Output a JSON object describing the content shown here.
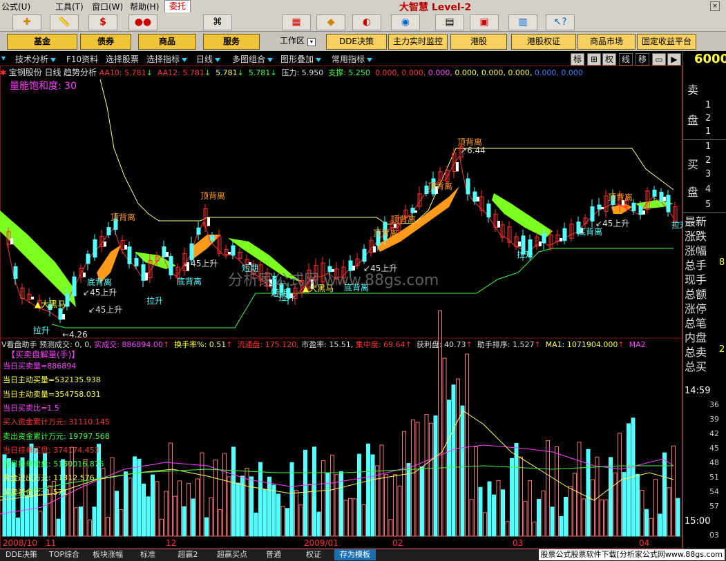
{
  "menu": {
    "items": [
      "公式(U)",
      "工具(T)",
      "窗口(W)",
      "帮助(H)"
    ],
    "entrust": "委托",
    "brand": "大智慧",
    "brand_level": "Level-2"
  },
  "toolbar_icons": [
    "add-icon",
    "ruler-icon",
    "dollar-icon",
    "traffic-light-icon",
    "binoculars-icon",
    "news-icon",
    "diamond-icon",
    "speed-icon",
    "disc-icon",
    "calendar-icon",
    "phone-icon",
    "board-icon",
    "books-icon",
    "help-cursor-icon"
  ],
  "nav_buttons": {
    "fund": "基金",
    "bond": "债券",
    "goods": "商品",
    "service": "服务",
    "workarea": "工作区",
    "dde": "DDE决策",
    "monitor": "主力实时监控",
    "hk": "港股",
    "hk_warrant": "港股权证",
    "goods_market": "商品市场",
    "fixed_income": "固定收益平台"
  },
  "tabs": {
    "tech": "技术分析",
    "f10": "F10资料",
    "pick_stock": "选择股票",
    "pick_indicator": "选择指标",
    "daily": "日线",
    "multi_combo": "多图组合",
    "overlay": "图形叠加",
    "common_ind": "常用指标",
    "right_tabs": [
      "标",
      "⊞",
      "权",
      "线",
      "移",
      "▭",
      "▶"
    ],
    "price_display": "6000"
  },
  "info": {
    "stock_title": "宝钢股份 日线",
    "trend": "趋势分析",
    "aa10": "AA10: 5.781",
    "aa12": "AA12: 5.781",
    "v3": "5.781",
    "v4": "5.781",
    "pressure": "压力: 5.950",
    "support": "支撑: 5.250",
    "zeros1": "0.000, 0.000,",
    "zeros2": "0.000,",
    "zeros3": "0.000, 0.000, 0.000,",
    "zeros4": "0.000,",
    "zeros5": "0.000",
    "saturation": "量能饱和度: 30",
    "watermark": "分析家公式网 www.88gs.com"
  },
  "annotations": {
    "top_div": "顶背离",
    "bottom_div": "底背离",
    "rise45": "45上升",
    "pull_up": "拉升",
    "big_black_horse": "大黑马",
    "short_term": "短期",
    "peak_value": "6.44",
    "low_value": "4.26"
  },
  "sub": {
    "header_title": "V看盘助手",
    "forecast": "预测成交: 0, 0,",
    "actual": "实成交: 886894.00",
    "turnover": "换手率%: 0.51",
    "float": "流通盘: 175.120,",
    "pe": "市盈率: 15.51,",
    "concentration": "集中度: 69.64",
    "profit": "获利盘: 40.73",
    "rank": "助手排序: 1.527",
    "ma1": "MA1: 1071904.000",
    "ma2": "MA2",
    "panel_title": "【买卖盘解量(手)】",
    "lines": [
      {
        "text": "当日买卖量=886894",
        "color": "#ff40ff"
      },
      {
        "text": "当日主动买量=532135.938",
        "color": "#ffff40"
      },
      {
        "text": "当日主动卖量=354758.031",
        "color": "#ffff40"
      },
      {
        "text": "当日买卖比=1.5",
        "color": "#ff40ff"
      },
      {
        "text": "买入资金累计万元: 31110.145",
        "color": "#ff3030"
      },
      {
        "text": "卖出资金累计万元: 19797.568",
        "color": "#40ff40"
      },
      {
        "text": "当日挂单买盘: 374174.453",
        "color": "#ff3030"
      },
      {
        "text": "当日挂单卖盘: 5160016.875",
        "color": "#40ff40"
      },
      {
        "text": "资金进出万元: 11312.576",
        "color": "#ffff40"
      },
      {
        "text": "买卖资金比: 1.571",
        "color": "#ffff40"
      }
    ]
  },
  "xaxis": [
    "2008/10",
    "11",
    "12",
    "2009/01",
    "02",
    "03",
    "04"
  ],
  "right_panel": {
    "sell_label": [
      "卖",
      "盘"
    ],
    "buy_label": [
      "买",
      "盘"
    ],
    "sell_nums": [
      "1",
      "2",
      "1"
    ],
    "buy_nums": [
      "1",
      "2",
      "3",
      "4",
      "5"
    ],
    "fields": [
      "最新",
      "涨跌",
      "涨幅",
      "总手",
      "现手",
      "总额",
      "涨停",
      "总笔",
      "内盘",
      "总卖",
      "总买"
    ],
    "field_vals": [
      "",
      "",
      "",
      "8",
      "",
      "",
      "",
      "",
      "",
      "2",
      ""
    ],
    "times": [
      "14:59",
      "36",
      "39",
      "42",
      "45",
      "48",
      "51",
      "54",
      "57",
      "15:00",
      "03"
    ]
  },
  "bottom_tabs": [
    "DDE决策",
    "TOP综合",
    "板块涨幅",
    "标准",
    "超赢2",
    "超赢买点",
    "普通",
    "权证",
    "存为模板"
  ],
  "ad_text": "股票公式股票软件下载[分析家公式网www.88gs.com",
  "colors": {
    "up": "#ff3030",
    "down": "#54ffff",
    "band_green": "#7cff20",
    "band_orange": "#ff9a1a",
    "gold": "#f0c438"
  }
}
